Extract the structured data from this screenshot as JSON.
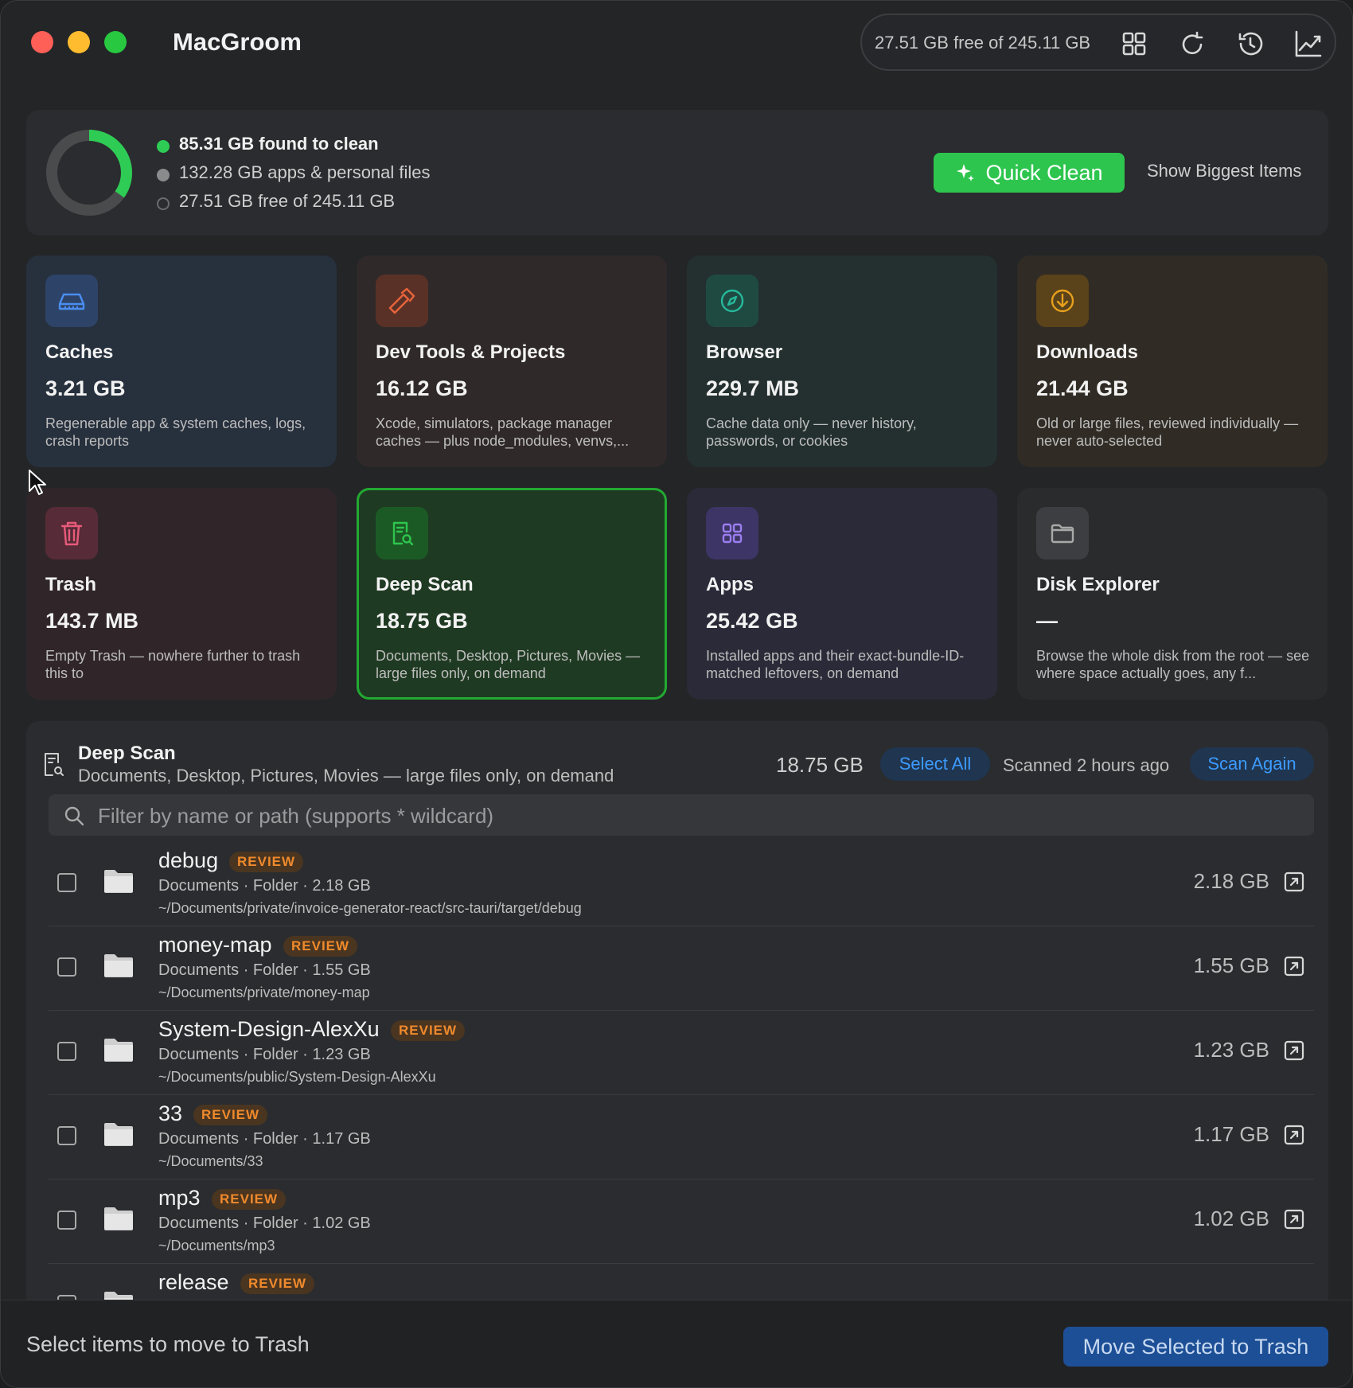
{
  "app": {
    "title": "MacGroom",
    "toolbar_free": "27.51 GB free of 245.11 GB",
    "toolbar_icons": [
      "grid-icon",
      "refresh-icon",
      "history-icon",
      "chart-icon"
    ]
  },
  "summary": {
    "found": "85.31 GB found to clean",
    "apps_personal": "132.28 GB apps & personal files",
    "free": "27.51 GB free of 245.11 GB",
    "quick_clean": "Quick Clean",
    "show_biggest": "Show Biggest Items",
    "donut_fraction_found": 0.348,
    "colors": {
      "found": "#2ecc55",
      "apps": "#4a4b4d"
    }
  },
  "cards": [
    {
      "name": "Caches",
      "size": "3.21 GB",
      "desc": "Regenerable app & system caches, logs, crash reports",
      "icon": "drive-icon",
      "accent": "#4a8ef0"
    },
    {
      "name": "Dev Tools & Projects",
      "size": "16.12 GB",
      "desc": "Xcode, simulators, package manager caches — plus node_modules, venvs,...",
      "icon": "hammer-icon",
      "accent": "#e8643c"
    },
    {
      "name": "Browser",
      "size": "229.7 MB",
      "desc": "Cache data only — never history, passwords, or cookies",
      "icon": "compass-icon",
      "accent": "#26b89a"
    },
    {
      "name": "Downloads",
      "size": "21.44 GB",
      "desc": "Old or large files, reviewed individually — never auto-selected",
      "icon": "download-icon",
      "accent": "#e7a01d"
    },
    {
      "name": "Trash",
      "size": "143.7 MB",
      "desc": "Empty Trash — nowhere further to trash this to",
      "icon": "trash-icon",
      "accent": "#e85a7a"
    },
    {
      "name": "Deep Scan",
      "size": "18.75 GB",
      "desc": "Documents, Desktop, Pictures, Movies — large files only, on demand",
      "icon": "doc-search-icon",
      "accent": "#2ec54e"
    },
    {
      "name": "Apps",
      "size": "25.42 GB",
      "desc": "Installed apps and their exact-bundle-ID-matched leftovers, on demand",
      "icon": "apps-grid-icon",
      "accent": "#9c7ef0"
    },
    {
      "name": "Disk Explorer",
      "size": "—",
      "desc": "Browse the whole disk from the root — see where space actually goes, any f...",
      "icon": "folder-icon",
      "accent": "#a9a9a9"
    }
  ],
  "panel": {
    "title": "Deep Scan",
    "subtitle": "Documents, Desktop, Pictures, Movies — large files only, on demand",
    "size": "18.75 GB",
    "select_all": "Select All",
    "scanned": "Scanned 2 hours ago",
    "scan_again": "Scan Again",
    "filter_placeholder": "Filter by name or path (supports * wildcard)",
    "badge": "REVIEW",
    "rows": [
      {
        "name": "debug",
        "meta": "Documents · Folder · 2.18 GB",
        "path": "~/Documents/private/invoice-generator-react/src-tauri/target/debug",
        "size": "2.18 GB"
      },
      {
        "name": "money-map",
        "meta": "Documents · Folder · 1.55 GB",
        "path": "~/Documents/private/money-map",
        "size": "1.55 GB"
      },
      {
        "name": "System-Design-AlexXu",
        "meta": "Documents · Folder · 1.23 GB",
        "path": "~/Documents/public/System-Design-AlexXu",
        "size": "1.23 GB"
      },
      {
        "name": "33",
        "meta": "Documents · Folder · 1.17 GB",
        "path": "~/Documents/33",
        "size": "1.17 GB"
      },
      {
        "name": "mp3",
        "meta": "Documents · Folder · 1.02 GB",
        "path": "~/Documents/mp3",
        "size": "1.02 GB"
      },
      {
        "name": "release",
        "meta": "",
        "path": "",
        "size": ""
      }
    ]
  },
  "footer": {
    "hint": "Select items to move to Trash",
    "move_button": "Move Selected to Trash"
  }
}
